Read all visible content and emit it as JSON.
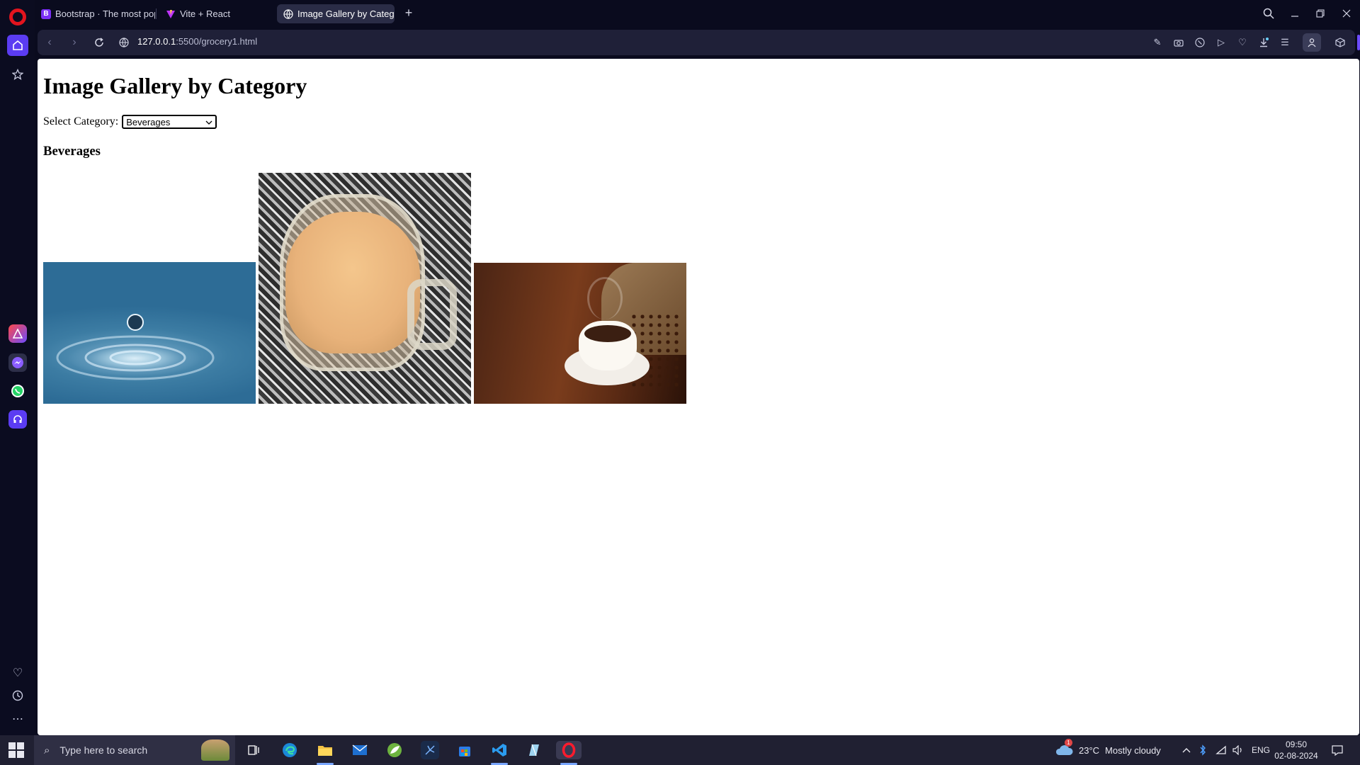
{
  "browser": {
    "tabs": [
      {
        "label": "Bootstrap · The most popu",
        "icon": "bootstrap-icon"
      },
      {
        "label": "Vite + React",
        "icon": "vite-icon"
      },
      {
        "label": "Image Gallery by Categor",
        "icon": "globe-icon",
        "active": true
      }
    ],
    "address": {
      "host": "127.0.0.1",
      "path": ":5500/grocery1.html"
    }
  },
  "page": {
    "title": "Image Gallery by Category",
    "select_label": "Select Category:",
    "selected_category": "Beverages",
    "category_heading": "Beverages",
    "images": [
      {
        "name": "water-drop-image"
      },
      {
        "name": "tea-glass-image"
      },
      {
        "name": "coffee-cup-image"
      }
    ]
  },
  "taskbar": {
    "search_placeholder": "Type here to search",
    "weather_temp": "23°C",
    "weather_text": "Mostly cloudy",
    "weather_badge": "1",
    "language": "ENG",
    "time": "09:50",
    "date": "02-08-2024"
  },
  "colors": {
    "accent": "#5b3cf2",
    "opera_red": "#e3141e",
    "chrome_bg": "#0a0b1e"
  }
}
